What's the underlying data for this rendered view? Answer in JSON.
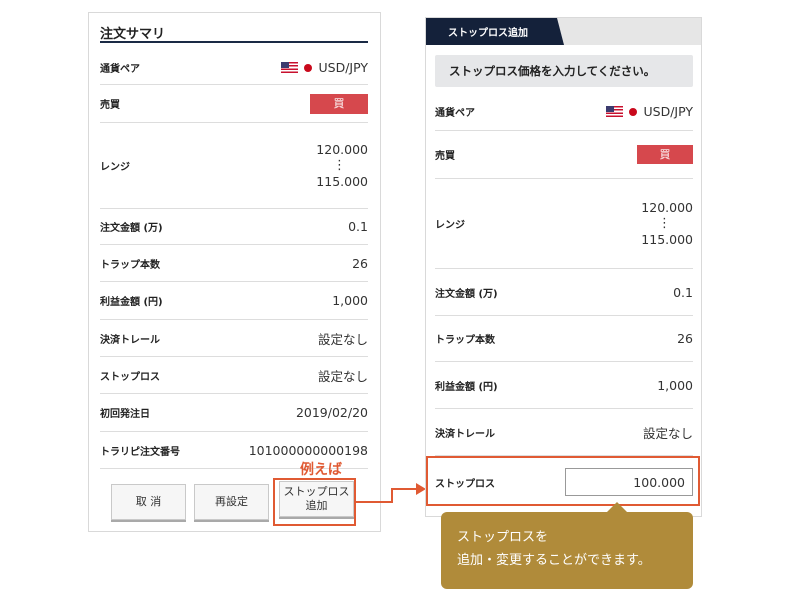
{
  "summary": {
    "title": "注文サマリ",
    "rows": {
      "pair_label": "通貨ペア",
      "pair_value": "USD/JPY",
      "side_label": "売買",
      "side_value": "買",
      "range_label": "レンジ",
      "range_high": "120.000",
      "range_sep": "⋮",
      "range_low": "115.000",
      "amount_label": "注文金額 (万)",
      "amount_value": "0.1",
      "traps_label": "トラップ本数",
      "traps_value": "26",
      "profit_label": "利益金額 (円)",
      "profit_value": "1,000",
      "trail_label": "決済トレール",
      "trail_value": "設定なし",
      "stoploss_label": "ストップロス",
      "stoploss_value": "設定なし",
      "first_date_label": "初回発注日",
      "first_date_value": "2019/02/20",
      "order_no_label": "トラリピ注文番号",
      "order_no_value": "101000000000198"
    },
    "buttons": {
      "cancel": "取 消",
      "reset": "再設定",
      "add_stoploss_line1": "ストップロス",
      "add_stoploss_line2": "追加"
    },
    "example_label": "例えば"
  },
  "stoploss_panel": {
    "tab": "ストップロス追加",
    "prompt": "ストップロス価格を入力してください。",
    "rows": {
      "pair_label": "通貨ペア",
      "pair_value": "USD/JPY",
      "side_label": "売買",
      "side_value": "買",
      "range_label": "レンジ",
      "range_high": "120.000",
      "range_sep": "⋮",
      "range_low": "115.000",
      "amount_label": "注文金額 (万)",
      "amount_value": "0.1",
      "traps_label": "トラップ本数",
      "traps_value": "26",
      "profit_label": "利益金額 (円)",
      "profit_value": "1,000",
      "trail_label": "決済トレール",
      "trail_value": "設定なし",
      "stoploss_label": "ストップロス",
      "stoploss_input_value": "100.000"
    }
  },
  "callout": {
    "line1": "ストップロスを",
    "line2": "追加・変更することができます。"
  },
  "colors": {
    "navy": "#14213a",
    "buy_red": "#d6484d",
    "highlight_orange": "#e05a33",
    "callout_gold": "#b08b3a"
  },
  "icons": {
    "flag": "us-flag-icon",
    "dot": "japan-dot-icon"
  }
}
